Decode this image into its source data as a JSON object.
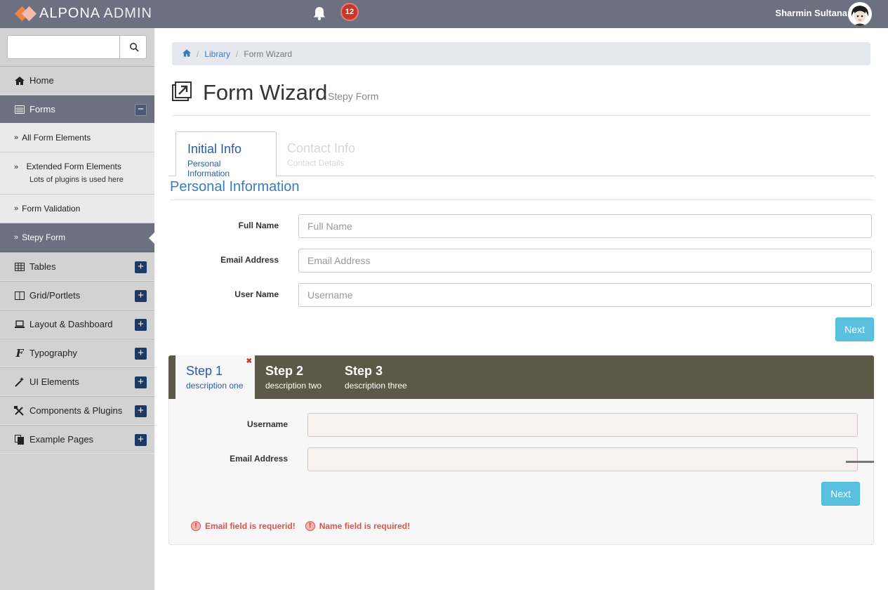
{
  "header": {
    "brand_primary": "ALPONA",
    "brand_secondary": "ADMIN",
    "notification_count": "12",
    "user_name": "Sharmin Sultana"
  },
  "sidebar": {
    "search_placeholder": "",
    "items": [
      {
        "label": "Home",
        "icon": "home-icon"
      },
      {
        "label": "Forms",
        "icon": "forms-icon",
        "expanded": true
      },
      {
        "label": "Tables",
        "icon": "table-icon"
      },
      {
        "label": "Grid/Portlets",
        "icon": "columns-icon"
      },
      {
        "label": "Layout & Dashboard",
        "icon": "laptop-icon"
      },
      {
        "label": "Typography",
        "icon": "font-icon"
      },
      {
        "label": "UI Elements",
        "icon": "magic-icon"
      },
      {
        "label": "Components & Plugins",
        "icon": "tools-icon"
      },
      {
        "label": "Example Pages",
        "icon": "pages-icon"
      }
    ],
    "sub_items": [
      {
        "label": "All Form Elements"
      },
      {
        "label": "Extended Form Elements",
        "desc": "Lots of plugins is used here"
      },
      {
        "label": "Form Validation"
      },
      {
        "label": "Stepy Form",
        "active": true
      }
    ]
  },
  "breadcrumb": {
    "items": [
      "Library",
      "Form Wizard"
    ]
  },
  "page": {
    "title": "Form Wizard",
    "subtitle": "Stepy Form"
  },
  "wizard1": {
    "tabs": [
      {
        "title": "Initial Info",
        "desc": "Personal Information",
        "active": true
      },
      {
        "title": "Contact Info",
        "desc": "Contact Details",
        "active": false
      }
    ],
    "legend": "Personal Information",
    "fields": [
      {
        "label": "Full Name",
        "placeholder": "Full Name"
      },
      {
        "label": "Email Address",
        "placeholder": "Email Address"
      },
      {
        "label": "User Name",
        "placeholder": "Username"
      }
    ],
    "next_label": "Next"
  },
  "wizard2": {
    "steps": [
      {
        "title": "Step 1",
        "desc": "description one",
        "active": true
      },
      {
        "title": "Step 2",
        "desc": "description two",
        "active": false
      },
      {
        "title": "Step 3",
        "desc": "description three",
        "active": false
      }
    ],
    "fields": [
      {
        "label": "Username"
      },
      {
        "label": "Email Address"
      }
    ],
    "next_label": "Next",
    "errors": [
      "Email field is requerid!",
      "Name field is required!"
    ]
  },
  "colors": {
    "topbar": "#6b7181",
    "sidebar": "#d2d2d2",
    "accent_blue": "#3a7bbf",
    "info_button": "#5bc0de",
    "step_bar": "#5c5948",
    "error": "#d9534f"
  }
}
